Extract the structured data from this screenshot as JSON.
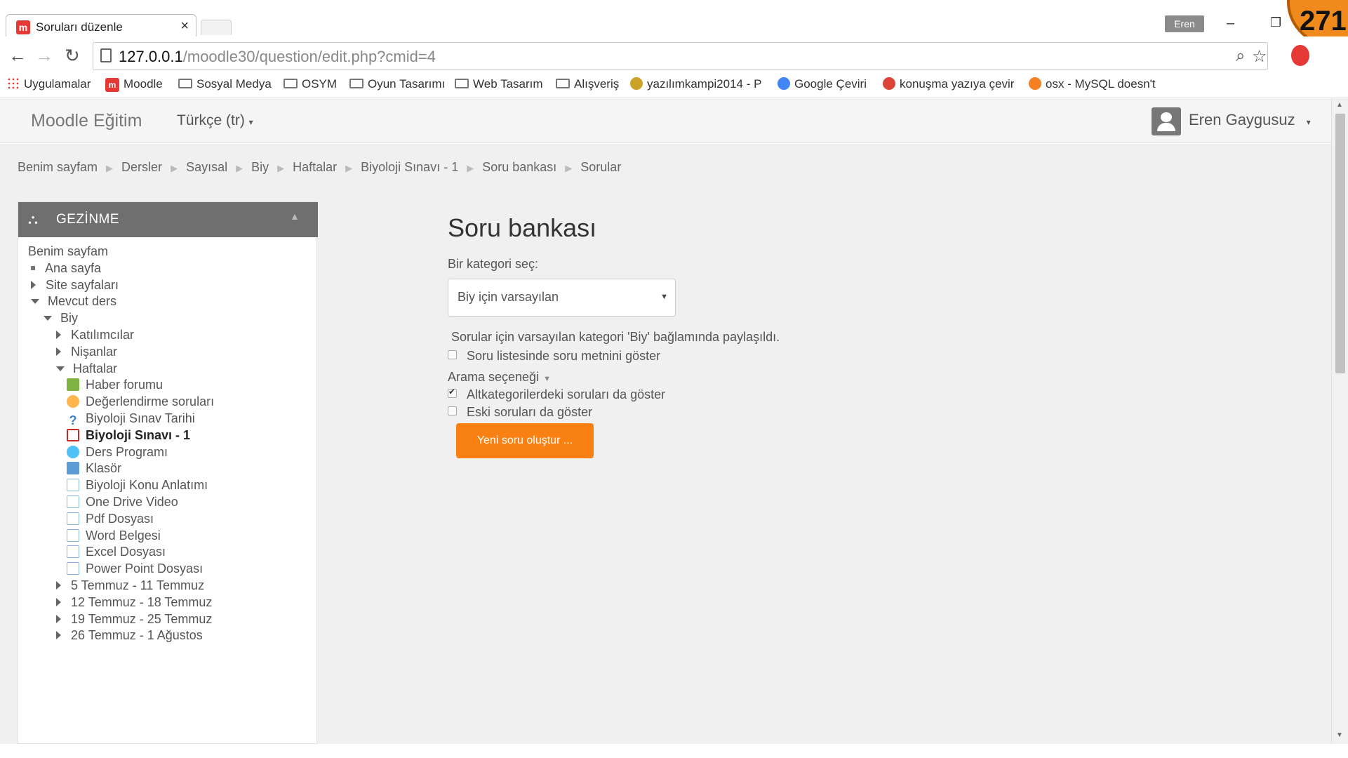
{
  "browser": {
    "tab_title": "Soruları düzenle",
    "tab_favicon": "m",
    "profile_name": "Eren",
    "url_host": "127.0.0.1",
    "url_path": "/moodle30/question/edit.php?cmid=4",
    "badge_number": "271",
    "bookmarks": [
      {
        "label": "Uygulamalar",
        "icon": "apps-icon"
      },
      {
        "label": "Moodle",
        "icon": "moodle-icon"
      },
      {
        "label": "Sosyal Medya",
        "icon": "folder-icon"
      },
      {
        "label": "OSYM",
        "icon": "folder-icon"
      },
      {
        "label": "Oyun Tasarımı",
        "icon": "folder-icon"
      },
      {
        "label": "Web Tasarım",
        "icon": "folder-icon"
      },
      {
        "label": "Alışveriş",
        "icon": "folder-icon"
      },
      {
        "label": "yazılımkampi2014 - P",
        "icon": "site-icon"
      },
      {
        "label": "Google Çeviri",
        "icon": "translate-icon"
      },
      {
        "label": "konuşma yazıya çevir",
        "icon": "chrome-icon"
      },
      {
        "label": "osx - MySQL doesn't",
        "icon": "stackoverflow-icon"
      }
    ]
  },
  "navbar": {
    "brand": "Moodle Eğitim",
    "language": "Türkçe ‎(tr)‎",
    "user_name": "Eren Gaygusuz"
  },
  "breadcrumb": [
    "Benim sayfam",
    "Dersler",
    "Sayısal",
    "Biy",
    "Haftalar",
    "Biyoloji Sınavı - 1",
    "Soru bankası",
    "Sorular"
  ],
  "nav_block": {
    "title": "GEZİNME",
    "items": [
      {
        "label": "Benim sayfam",
        "marker": "none",
        "depth": 0
      },
      {
        "label": "Ana sayfa",
        "marker": "bullet",
        "depth": 1
      },
      {
        "label": "Site sayfaları",
        "marker": "collapsed",
        "depth": 1
      },
      {
        "label": "Mevcut ders",
        "marker": "expanded",
        "depth": 1
      },
      {
        "label": "Biy",
        "marker": "expanded",
        "depth": 2
      },
      {
        "label": "Katılımcılar",
        "marker": "collapsed",
        "depth": 3
      },
      {
        "label": "Nişanlar",
        "marker": "collapsed",
        "depth": 3
      },
      {
        "label": "Haftalar",
        "marker": "expanded",
        "depth": 3
      },
      {
        "label": "Haber forumu",
        "marker": "forum",
        "depth": 4
      },
      {
        "label": "Değerlendirme soruları",
        "marker": "feedback",
        "depth": 4
      },
      {
        "label": "Biyoloji Sınav Tarihi",
        "marker": "question",
        "depth": 4
      },
      {
        "label": "Biyoloji Sınavı - 1",
        "marker": "quiz",
        "depth": 4,
        "active": true
      },
      {
        "label": "Ders Programı",
        "marker": "lesson",
        "depth": 4
      },
      {
        "label": "Klasör",
        "marker": "folder",
        "depth": 4
      },
      {
        "label": "Biyoloji Konu Anlatımı",
        "marker": "page",
        "depth": 4
      },
      {
        "label": "One Drive Video",
        "marker": "page",
        "depth": 4
      },
      {
        "label": "Pdf Dosyası",
        "marker": "page",
        "depth": 4
      },
      {
        "label": "Word Belgesi",
        "marker": "page",
        "depth": 4
      },
      {
        "label": "Excel Dosyası",
        "marker": "page",
        "depth": 4
      },
      {
        "label": "Power Point Dosyası",
        "marker": "page",
        "depth": 4
      },
      {
        "label": "5 Temmuz - 11 Temmuz",
        "marker": "collapsed",
        "depth": 3
      },
      {
        "label": "12 Temmuz - 18 Temmuz",
        "marker": "collapsed",
        "depth": 3
      },
      {
        "label": "19 Temmuz - 25 Temmuz",
        "marker": "collapsed",
        "depth": 3
      },
      {
        "label": "26 Temmuz - 1 Ağustos",
        "marker": "collapsed",
        "depth": 3
      }
    ]
  },
  "main": {
    "title": "Soru bankası",
    "category_label": "Bir kategori seç:",
    "category_value": "Biy için varsayılan",
    "info": "Sorular için varsayılan kategori 'Biy' bağlamında paylaşıldı.",
    "show_question_text": {
      "label": "Soru listesinde soru metnini göster",
      "checked": false
    },
    "search_options": "Arama seçeneği",
    "show_subcategories": {
      "label": "Altkategorilerdeki soruları da göster",
      "checked": true
    },
    "show_old": {
      "label": "Eski soruları da göster",
      "checked": false
    },
    "new_question_button": "Yeni soru oluştur ..."
  },
  "colors": {
    "accent": "#f98012",
    "block_header": "#6f6f6f",
    "badge": "#f08a1c"
  }
}
